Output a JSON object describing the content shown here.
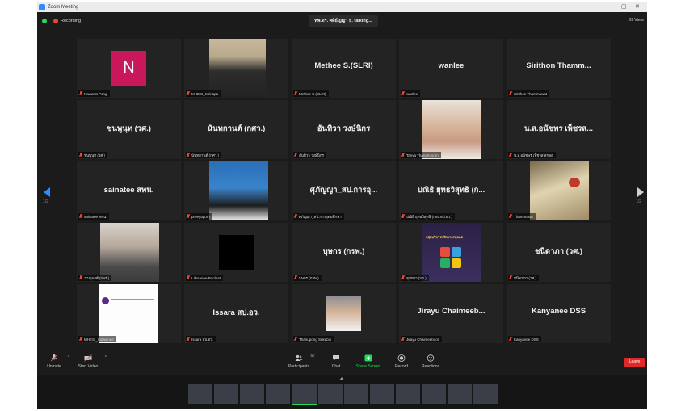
{
  "window": {
    "title": "Zoom Meeting",
    "controls": [
      "—",
      "▢",
      "✕"
    ]
  },
  "top": {
    "recording_label": "Recording",
    "speaker": "ทพ.ดร. ศศิธัญญา ธ. talking...",
    "view_label": "View"
  },
  "nav": {
    "prev_page": "1/2",
    "next_page": "1/2"
  },
  "tiles": [
    {
      "big": "",
      "label": "Nawarat Pong",
      "avatar": "N"
    },
    {
      "big": "",
      "label": "MHESI_Sirinapa"
    },
    {
      "big": "Methee S.(SLRI)",
      "label": "Methee S.(SLRI)"
    },
    {
      "big": "wanlee",
      "label": "wanlee"
    },
    {
      "big": "Sirithon Thamm...",
      "label": "Sirithon Thammawat"
    },
    {
      "big": "ชนพูนุท (วศ.)",
      "label": "ชนพูนุท (วศ.)"
    },
    {
      "big": "นันทกานต์ (กศว.)",
      "label": "นันทกานต์ (กศว.)"
    },
    {
      "big": "อันทิวา วงษ์นิกร",
      "label": "อันทิวา วงษ์นิกร"
    },
    {
      "big": "",
      "label": "Tanya Thananusorn"
    },
    {
      "big": "น.ส.อนัชพร เพ็ชรส...",
      "label": "น.ส.อนัชพร เพ็ชรส สกลอ"
    },
    {
      "big": "sainatee สทน.",
      "label": "sainatee สทน."
    },
    {
      "big": "",
      "label": "preeyaporn"
    },
    {
      "big": "ศุภัญญา_สป.การอุ...",
      "label": "ศุภัญญา_สป.การอุดมศึกษา"
    },
    {
      "big": "ปณิธิ ยุทธวิสุทธิ (ก...",
      "label": "ปณิธิ ยุทธวิสุทธิ (กอง.สป.อว.)"
    },
    {
      "big": "",
      "label": "Thammasat"
    },
    {
      "big": "",
      "label": "ภาณุพงศ์ (กพร.)"
    },
    {
      "big": "",
      "label": "Laksanee Poolpat"
    },
    {
      "big": "บุษกร (กรพ.)",
      "label": "บุษกร (กรพ.)"
    },
    {
      "big": "",
      "label": "สุภัทรา (บก.)"
    },
    {
      "big": "ชนิดาภา (วศ.)",
      "label": "ชนิดาภา (วศ.)"
    },
    {
      "big": "",
      "label": "MHESI_Sutasinee"
    },
    {
      "big": "Issara สป.อว.",
      "label": "Issara สป.อว."
    },
    {
      "big": "",
      "label": "Thanupong Srikabis"
    },
    {
      "big": "Jirayu Chaimeeb...",
      "label": "Jirayu Chaimeeboon"
    },
    {
      "big": "Kanyanee DSS",
      "label": "Kanyanee DSS"
    }
  ],
  "slide_text": "กลุ่มบริหารทรัพยากรบุคคล",
  "toolbar": {
    "unmute": "Unmute",
    "start_video": "Start Video",
    "participants": "Participants",
    "participants_count": "67",
    "chat": "Chat",
    "share_screen": "Share Screen",
    "record": "Record",
    "reactions": "Reactions",
    "leave": "Leave"
  },
  "colors": {
    "accent": "#2d8cff",
    "recording": "#e8453c",
    "share": "#23d959",
    "leave": "#e02828"
  }
}
